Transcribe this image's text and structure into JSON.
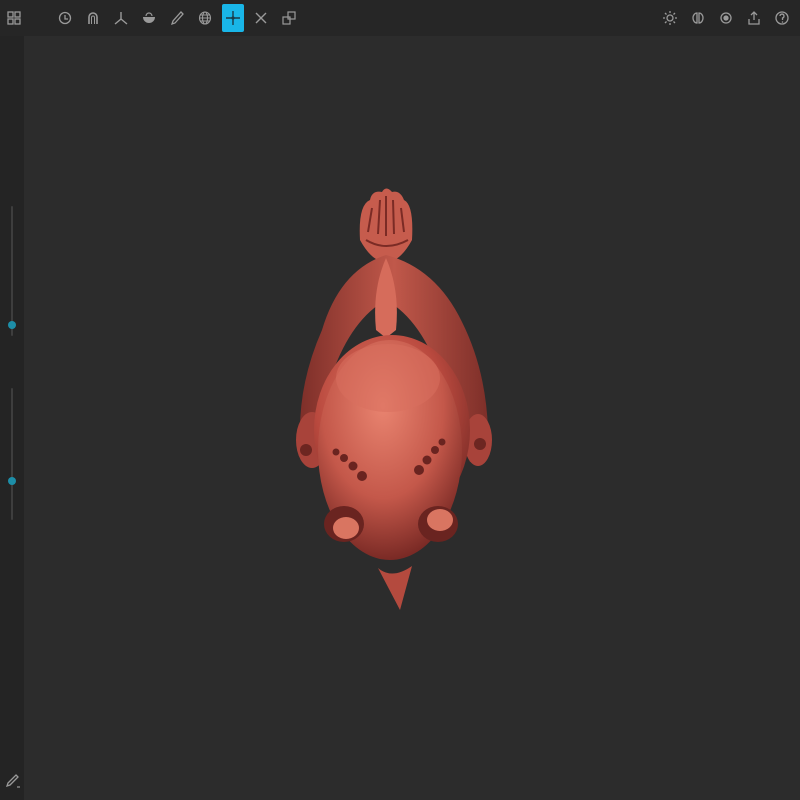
{
  "toolbar": {
    "left_tools": [
      {
        "name": "menu-grid",
        "icon": "grid-icon"
      },
      {
        "name": "clay",
        "icon": "clay-icon"
      },
      {
        "name": "magnet",
        "icon": "magnet-icon"
      },
      {
        "name": "crease",
        "icon": "crease-icon"
      },
      {
        "name": "inflate",
        "icon": "bowl-icon"
      },
      {
        "name": "brush",
        "icon": "brush-icon"
      },
      {
        "name": "mask",
        "icon": "mesh-sphere-icon"
      },
      {
        "name": "move",
        "icon": "move-icon",
        "active": true
      },
      {
        "name": "transform",
        "icon": "cross-arrows-icon"
      },
      {
        "name": "scale",
        "icon": "scale-box-icon"
      }
    ],
    "right_tools": [
      {
        "name": "settings",
        "icon": "gear-icon"
      },
      {
        "name": "symmetry",
        "icon": "symmetry-icon"
      },
      {
        "name": "material",
        "icon": "material-icon"
      },
      {
        "name": "export",
        "icon": "share-icon"
      },
      {
        "name": "help",
        "icon": "help-icon"
      }
    ],
    "accent_color": "#19b6e8"
  },
  "left_panel": {
    "sliders": [
      {
        "name": "radius-slider",
        "value": 0.9
      },
      {
        "name": "intensity-slider",
        "value": 0.7
      }
    ],
    "thumb_color": "#1d8ea8"
  },
  "viewport": {
    "background": "#2c2c2c",
    "model_color": "#c4584a"
  },
  "bottom_tool": {
    "icon": "pen-icon"
  }
}
